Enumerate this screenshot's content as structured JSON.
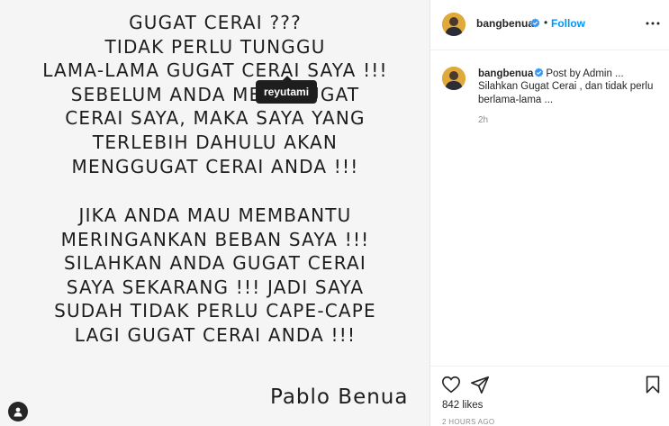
{
  "media": {
    "block1": [
      "GUGAT CERAI ???",
      "TIDAK PERLU TUNGGU",
      "LAMA-LAMA GUGAT CERAI SAYA !!!",
      "SEBELUM ANDA MENGGUGAT",
      "CERAI SAYA, MAKA SAYA YANG",
      "TERLEBIH DAHULU AKAN",
      "MENGGUGAT CERAI ANDA !!!"
    ],
    "block2": [
      "JIKA ANDA MAU MEMBANTU",
      "MERINGANKAN BEBAN SAYA !!!",
      "SILAHKAN ANDA GUGAT CERAI",
      "SAYA SEKARANG !!! JADI SAYA",
      "SUDAH TIDAK PERLU CAPE-CAPE",
      "LAGI GUGAT CERAI ANDA !!!"
    ],
    "signature": "Pablo Benua",
    "tag_label": "reyutami",
    "tagged_icon": "user-icon"
  },
  "header": {
    "username": "bangbenua",
    "separator": "•",
    "follow_label": "Follow",
    "verified_icon": "verified-badge-icon",
    "more_icon": "more-options-icon"
  },
  "caption": {
    "username": "bangbenua",
    "line1_text": "Post by Admin ...",
    "line2_text": "Silahkan Gugat Cerai , dan tidak perlu",
    "line3_text": "berlama-lama ...",
    "time": "2h"
  },
  "actions": {
    "like_icon": "heart-icon",
    "share_icon": "send-icon",
    "save_icon": "bookmark-icon",
    "likes_text": "842 likes",
    "date_text": "2 HOURS AGO"
  },
  "colors": {
    "accent": "#0095f6",
    "text": "#262626",
    "muted": "#8e8e8e",
    "poster_bg": "#f5f5f5"
  }
}
